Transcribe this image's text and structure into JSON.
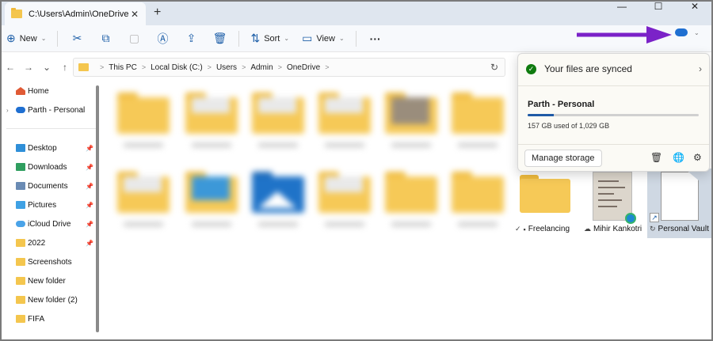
{
  "window": {
    "tab_title": "C:\\Users\\Admin\\OneDrive",
    "tab_close": "✕",
    "new_tab": "+",
    "minimize": "—",
    "maximize": "☐",
    "close": "✕"
  },
  "toolbar": {
    "new_label": "New",
    "sort_label": "Sort",
    "view_label": "View",
    "more": "···"
  },
  "nav": {
    "back": "←",
    "forward": "→",
    "recent": "⌄",
    "up": "↑"
  },
  "breadcrumb": [
    "This PC",
    "Local Disk (C:)",
    "Users",
    "Admin",
    "OneDrive"
  ],
  "breadcrumb_sep": ">",
  "sidebar": {
    "items": [
      {
        "label": "Home",
        "icon": "home-icon"
      },
      {
        "label": "Parth - Personal",
        "icon": "onedrive-icon"
      },
      {
        "label": "Desktop",
        "icon": "desktop-icon",
        "pinned": true
      },
      {
        "label": "Downloads",
        "icon": "downloads-icon",
        "pinned": true
      },
      {
        "label": "Documents",
        "icon": "documents-icon",
        "pinned": true
      },
      {
        "label": "Pictures",
        "icon": "pictures-icon",
        "pinned": true
      },
      {
        "label": "iCloud Drive",
        "icon": "icloud-icon",
        "pinned": true
      },
      {
        "label": "2022",
        "icon": "folder-icon",
        "pinned": true
      },
      {
        "label": "Screenshots",
        "icon": "folder-icon"
      },
      {
        "label": "New folder",
        "icon": "folder-icon"
      },
      {
        "label": "New folder (2)",
        "icon": "folder-icon"
      },
      {
        "label": "FIFA",
        "icon": "folder-icon"
      }
    ]
  },
  "files": {
    "freelancing": {
      "label": "Freelancing",
      "status": "✓"
    },
    "mihir": {
      "label": "Mihir Kankotri",
      "status": "☁"
    },
    "vault": {
      "label": "Personal Vault",
      "status": "↻"
    }
  },
  "onedrive_flyout": {
    "status": "Your files are synced",
    "status_icon": "check-icon",
    "account": "Parth - Personal",
    "usage_text": "157 GB used of 1,029 GB",
    "usage_fraction": 0.153,
    "manage_storage": "Manage storage"
  },
  "colors": {
    "accent": "#1f6fd1",
    "annotation_arrow": "#7b22c8",
    "folder": "#f6c957",
    "synced_green": "#0f7b0f"
  }
}
